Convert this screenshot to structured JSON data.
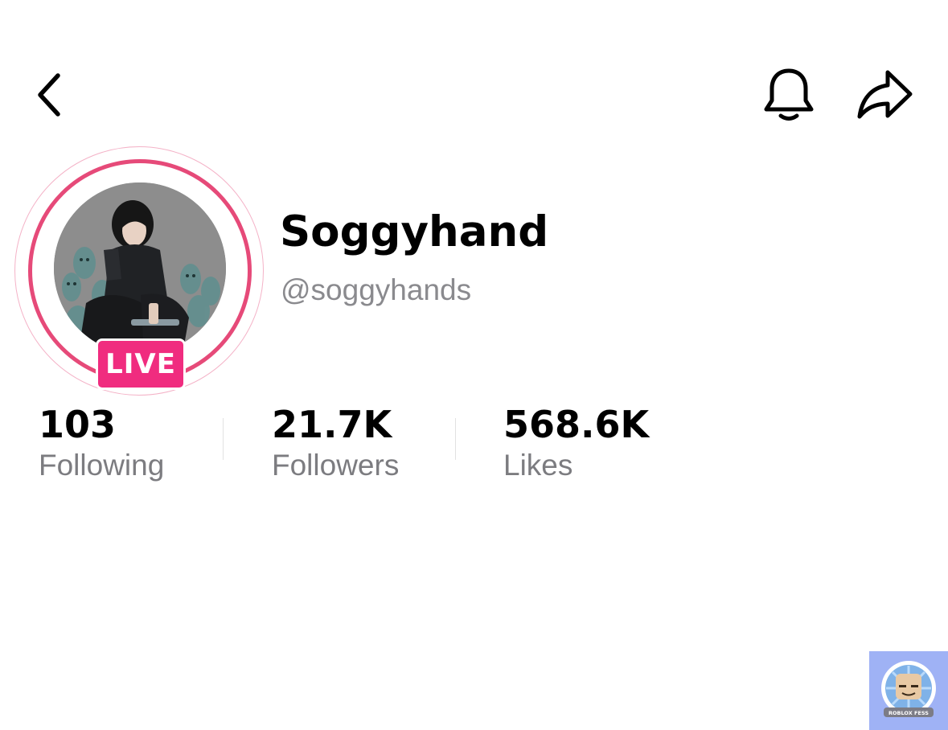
{
  "header": {
    "back_icon": "chevron-left-icon",
    "bell_icon": "bell-icon",
    "share_icon": "share-arrow-icon"
  },
  "profile": {
    "display_name": "Soggyhand",
    "handle": "@soggyhands",
    "live_badge": "LIVE",
    "ring_color": "#e64a79",
    "live_color": "#f02c7f"
  },
  "stats": [
    {
      "value": "103",
      "label": "Following"
    },
    {
      "value": "21.7K",
      "label": "Followers"
    },
    {
      "value": "568.6K",
      "label": "Likes"
    }
  ],
  "watermark": {
    "text": "ROBLOX FESS",
    "background": "#9fb2f5"
  }
}
